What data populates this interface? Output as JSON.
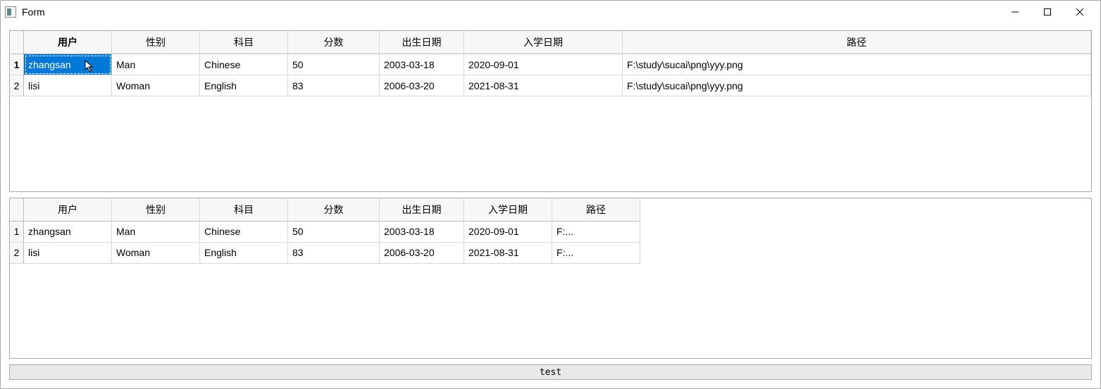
{
  "window": {
    "title": "Form"
  },
  "table1": {
    "columns": [
      "用户",
      "性别",
      "科目",
      "分数",
      "出生日期",
      "入学日期",
      "路径"
    ],
    "rowNumbers": [
      "1",
      "2"
    ],
    "selected": {
      "row": 0,
      "col": 0
    },
    "rows": [
      [
        "zhangsan",
        "Man",
        "Chinese",
        "50",
        "2003-03-18",
        "2020-09-01",
        "F:\\study\\sucai\\png\\yyy.png"
      ],
      [
        "lisi",
        "Woman",
        "English",
        "83",
        "2006-03-20",
        "2021-08-31",
        "F:\\study\\sucai\\png\\yyy.png"
      ]
    ]
  },
  "table2": {
    "columns": [
      "用户",
      "性别",
      "科目",
      "分数",
      "出生日期",
      "入学日期",
      "路径"
    ],
    "rowNumbers": [
      "1",
      "2"
    ],
    "rows": [
      [
        "zhangsan",
        "Man",
        "Chinese",
        "50",
        "2003-03-18",
        "2020-09-01",
        "F:..."
      ],
      [
        "lisi",
        "Woman",
        "English",
        "83",
        "2006-03-20",
        "2021-08-31",
        "F:..."
      ]
    ]
  },
  "button": {
    "label": "test"
  }
}
